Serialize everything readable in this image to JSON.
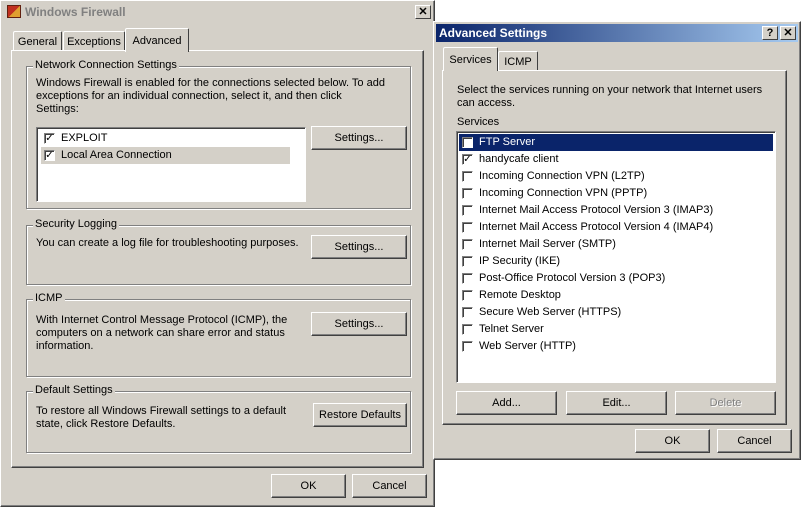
{
  "firewall": {
    "title": "Windows Firewall",
    "tabs": [
      "General",
      "Exceptions",
      "Advanced"
    ],
    "network": {
      "legend": "Network Connection Settings",
      "description": "Windows Firewall is enabled for the connections selected below. To add exceptions for an individual connection, select it, and then click Settings:",
      "connections": [
        {
          "label": "EXPLOIT",
          "checked": true
        },
        {
          "label": "Local Area Connection",
          "checked": true
        }
      ],
      "settings_label": "Settings..."
    },
    "logging": {
      "legend": "Security Logging",
      "description": "You can create a log file for troubleshooting purposes.",
      "settings_label": "Settings..."
    },
    "icmp": {
      "legend": "ICMP",
      "description": "With Internet Control Message Protocol (ICMP), the computers on a network can share error and status information.",
      "settings_label": "Settings..."
    },
    "defaults": {
      "legend": "Default Settings",
      "description": "To restore all Windows Firewall settings to a default state, click Restore Defaults.",
      "restore_label": "Restore Defaults"
    },
    "ok_label": "OK",
    "cancel_label": "Cancel",
    "close_glyph": "✕"
  },
  "advanced": {
    "title": "Advanced Settings",
    "help_glyph": "?",
    "close_glyph": "✕",
    "tabs": [
      "Services",
      "ICMP"
    ],
    "description": "Select the services running on your network that Internet users can access.",
    "services_label": "Services",
    "services": [
      {
        "label": "FTP Server",
        "checked": false,
        "selected": true
      },
      {
        "label": "handycafe client",
        "checked": true
      },
      {
        "label": "Incoming Connection VPN (L2TP)",
        "checked": false
      },
      {
        "label": "Incoming Connection VPN (PPTP)",
        "checked": false
      },
      {
        "label": "Internet Mail Access Protocol Version 3 (IMAP3)",
        "checked": false
      },
      {
        "label": "Internet Mail Access Protocol Version 4 (IMAP4)",
        "checked": false
      },
      {
        "label": "Internet Mail Server (SMTP)",
        "checked": false
      },
      {
        "label": "IP Security (IKE)",
        "checked": false
      },
      {
        "label": "Post-Office Protocol Version 3 (POP3)",
        "checked": false
      },
      {
        "label": "Remote Desktop",
        "checked": false
      },
      {
        "label": "Secure Web Server (HTTPS)",
        "checked": false
      },
      {
        "label": "Telnet Server",
        "checked": false
      },
      {
        "label": "Web Server (HTTP)",
        "checked": false
      }
    ],
    "add_label": "Add...",
    "edit_label": "Edit...",
    "delete_label": "Delete",
    "ok_label": "OK",
    "cancel_label": "Cancel"
  },
  "check_glyph": "✓"
}
